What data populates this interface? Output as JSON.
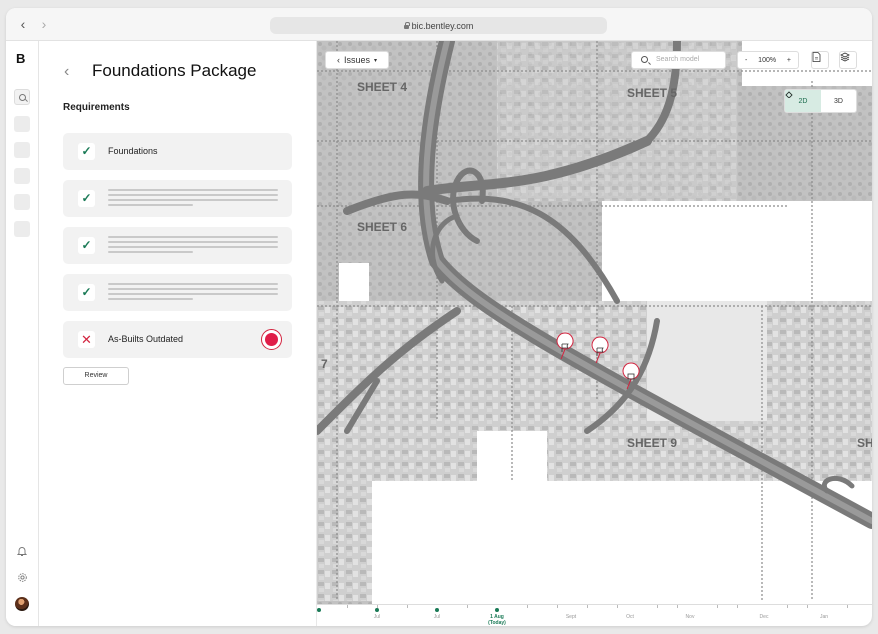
{
  "browser": {
    "url": "bic.bentley.com"
  },
  "rail": {
    "logo": "B"
  },
  "panel": {
    "title": "Foundations Package",
    "requirements_heading": "Requirements",
    "requirements": [
      {
        "label": "Foundations",
        "status": "complete"
      },
      {
        "label": "",
        "status": "complete"
      },
      {
        "label": "",
        "status": "complete"
      },
      {
        "label": "",
        "status": "complete"
      },
      {
        "label": "As-Builts Outdated",
        "status": "failed"
      }
    ],
    "review_label": "Review"
  },
  "map": {
    "issues_label": "Issues",
    "search_placeholder": "Search model",
    "zoom": "100%",
    "zoom_minus": "-",
    "zoom_plus": "+",
    "view_2d": "2D",
    "view_3d": "3D",
    "sheets": [
      "SHEET 4",
      "SHEET 5",
      "SHEET 6",
      "SHEET 9",
      "7",
      "SH"
    ],
    "issue_pin_count": 3
  },
  "timeline": {
    "labels": [
      "Jul",
      "Jul",
      "1 Aug",
      "(Today)",
      "Sept",
      "Oct",
      "Nov",
      "Dec",
      "Jan"
    ]
  },
  "colors": {
    "accent": "#1a7a56",
    "alert": "#e01d48"
  }
}
